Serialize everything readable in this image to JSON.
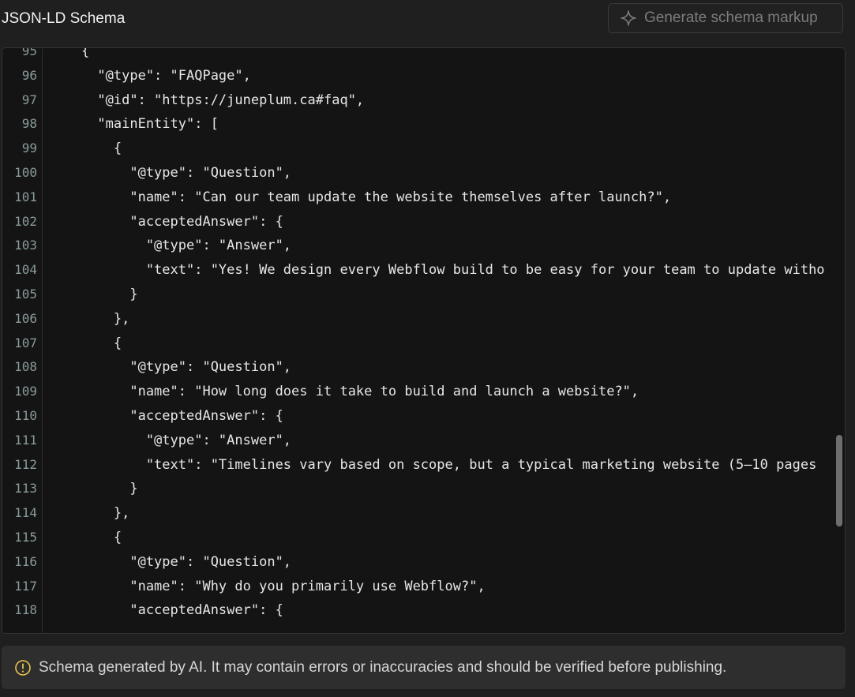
{
  "header": {
    "title": "JSON-LD Schema",
    "generate_button": {
      "label": "Generate schema markup",
      "icon": "sparkle-icon"
    }
  },
  "editor": {
    "lines": [
      {
        "number": "95",
        "text": "    {"
      },
      {
        "number": "96",
        "text": "      \"@type\": \"FAQPage\","
      },
      {
        "number": "97",
        "text": "      \"@id\": \"https://juneplum.ca#faq\","
      },
      {
        "number": "98",
        "text": "      \"mainEntity\": ["
      },
      {
        "number": "99",
        "text": "        {"
      },
      {
        "number": "100",
        "text": "          \"@type\": \"Question\","
      },
      {
        "number": "101",
        "text": "          \"name\": \"Can our team update the website themselves after launch?\","
      },
      {
        "number": "102",
        "text": "          \"acceptedAnswer\": {"
      },
      {
        "number": "103",
        "text": "            \"@type\": \"Answer\","
      },
      {
        "number": "104",
        "text": "            \"text\": \"Yes! We design every Webflow build to be easy for your team to update witho"
      },
      {
        "number": "105",
        "text": "          }"
      },
      {
        "number": "106",
        "text": "        },"
      },
      {
        "number": "107",
        "text": "        {"
      },
      {
        "number": "108",
        "text": "          \"@type\": \"Question\","
      },
      {
        "number": "109",
        "text": "          \"name\": \"How long does it take to build and launch a website?\","
      },
      {
        "number": "110",
        "text": "          \"acceptedAnswer\": {"
      },
      {
        "number": "111",
        "text": "            \"@type\": \"Answer\","
      },
      {
        "number": "112",
        "text": "            \"text\": \"Timelines vary based on scope, but a typical marketing website (5–10 pages"
      },
      {
        "number": "113",
        "text": "          }"
      },
      {
        "number": "114",
        "text": "        },"
      },
      {
        "number": "115",
        "text": "        {"
      },
      {
        "number": "116",
        "text": "          \"@type\": \"Question\","
      },
      {
        "number": "117",
        "text": "          \"name\": \"Why do you primarily use Webflow?\","
      },
      {
        "number": "118",
        "text": "          \"acceptedAnswer\": {"
      }
    ]
  },
  "notice": {
    "icon": "warning-circle-icon",
    "text": "Schema generated by AI. It may contain errors or inaccuracies and should be verified before publishing.",
    "icon_color": "#e8c34a"
  }
}
